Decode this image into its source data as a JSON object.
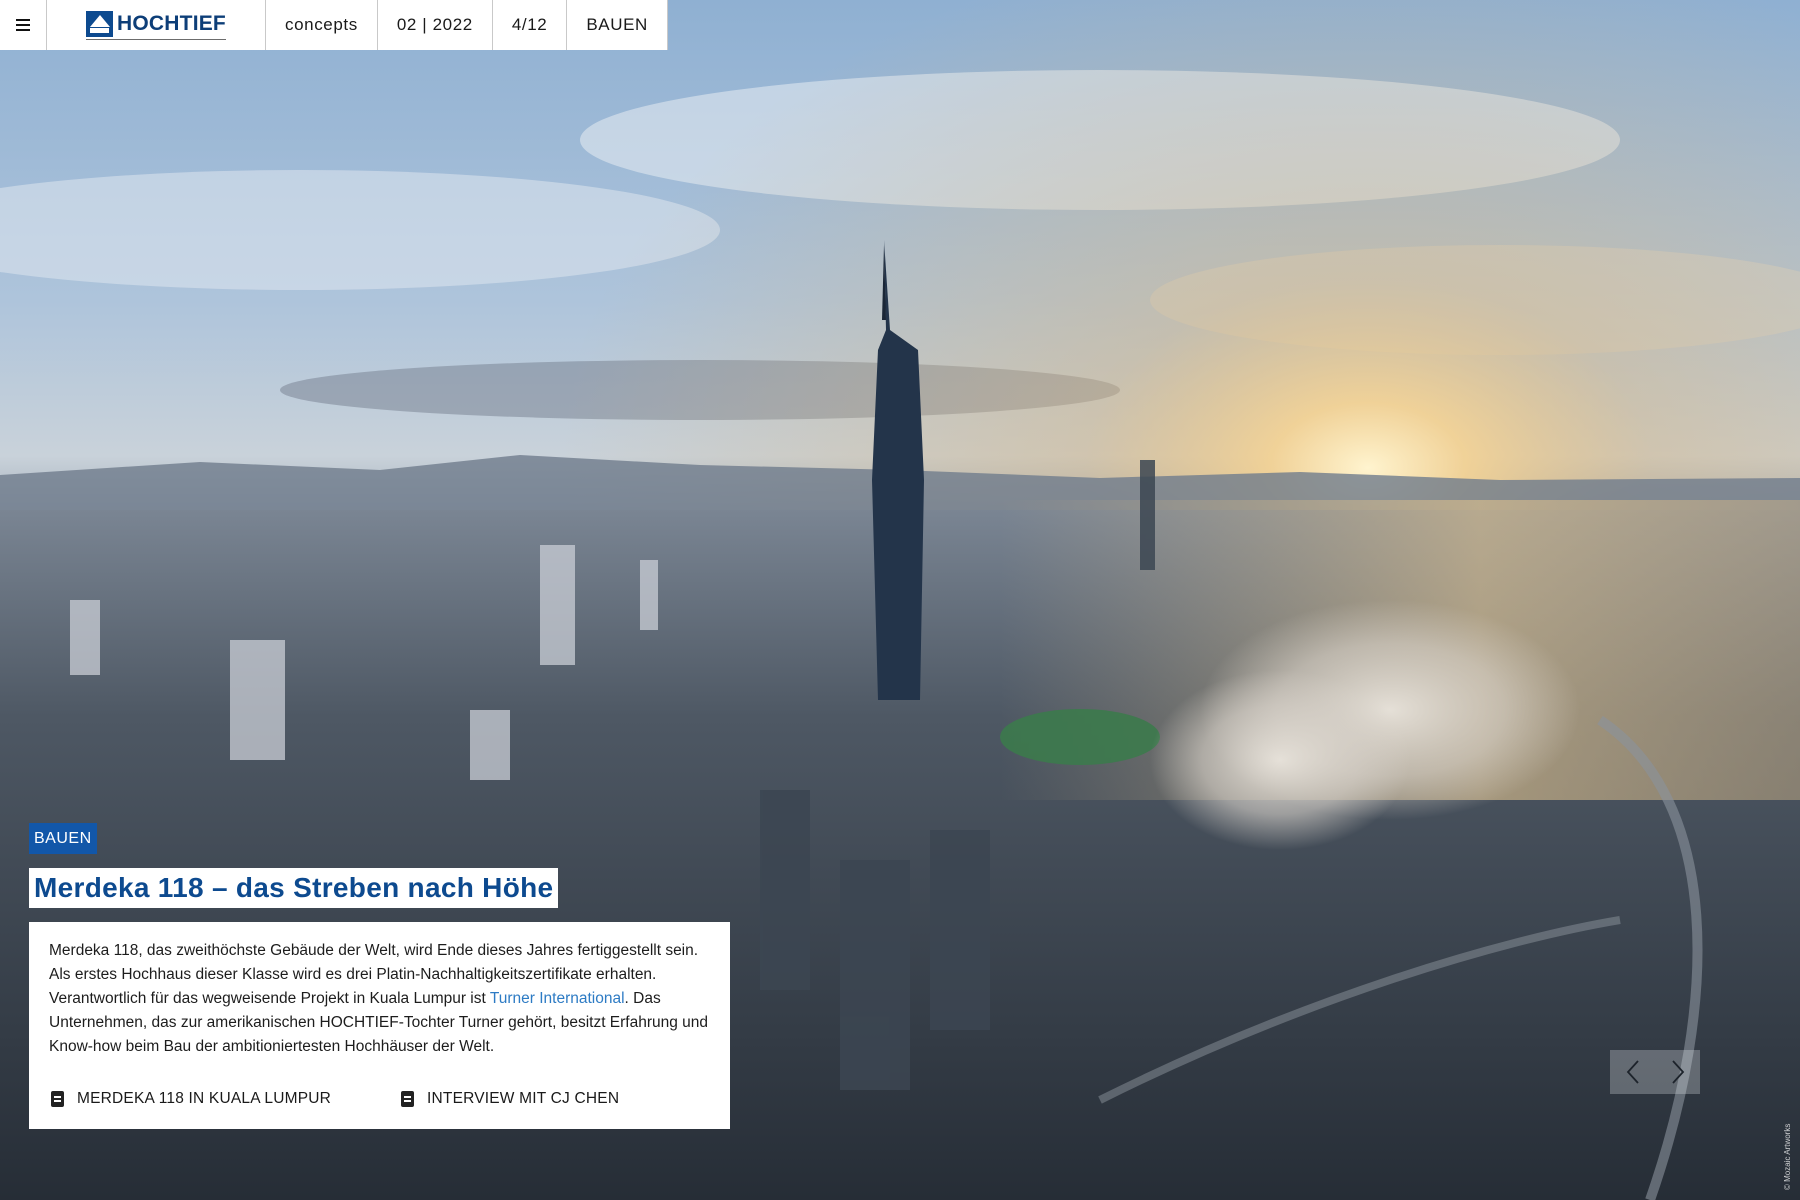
{
  "nav": {
    "menu_icon": "hamburger-menu-icon",
    "logo_text": "HOCHTIEF",
    "items": [
      "concepts",
      "02 | 2022",
      "4/12",
      "BAUEN"
    ]
  },
  "article": {
    "tag": "BAUEN",
    "headline": "Merdeka 118 – das Streben nach Höhe",
    "body_before_link": "Merdeka 118, das zweithöchste Gebäude der Welt, wird Ende dieses Jahres fertiggestellt sein. Als erstes Hochhaus dieser Klasse wird es drei Platin-Nachhaltigkeitszertifikate erhalten. Verantwortlich für das wegweisende Projekt in Kuala Lumpur ist ",
    "body_link": "Turner International",
    "body_after_link": ". Das Unternehmen, das zur amerikanischen HOCHTIEF-Tochter Turner gehört, besitzt Erfahrung und Know-how beim Bau der ambitioniertesten Hochhäuser der Welt.",
    "links": [
      {
        "label": "MERDEKA 118 IN KUALA LUMPUR",
        "icon": "document-icon"
      },
      {
        "label": "INTERVIEW MIT CJ CHEN",
        "icon": "document-icon"
      }
    ]
  },
  "slider": {
    "prev_icon": "chevron-left-icon",
    "next_icon": "chevron-right-icon"
  },
  "photo_credit": "© Mozaic Artworks",
  "colors": {
    "accent_blue": "#1257a9",
    "headline_blue": "#0d4a8f",
    "link_blue": "#2d7bc4"
  }
}
